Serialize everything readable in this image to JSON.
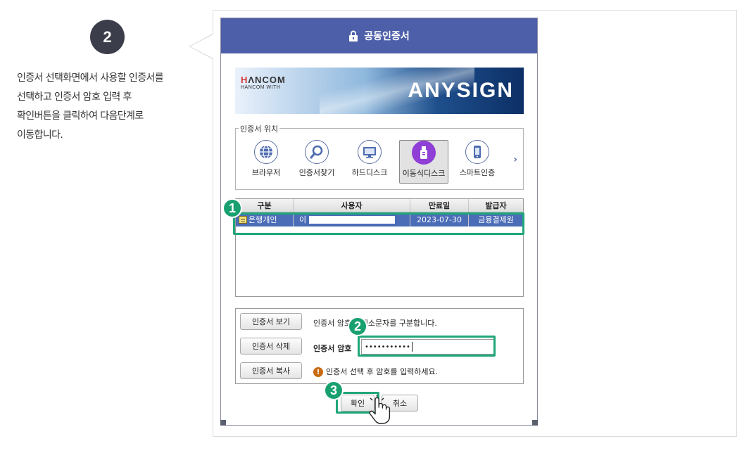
{
  "step": {
    "number": "2"
  },
  "description": "인증서 선택화면에서 사용할 인증서를\n선택하고 인증서 암호 입력 후\n확인버튼을 클릭하여 다음단계로\n이동합니다.",
  "dialog": {
    "title": "공동인증서",
    "banner": {
      "brand": "HANCOM",
      "brand_sub": "HANCOM WITH",
      "product": "ANYSIGN"
    },
    "location": {
      "legend": "인증서 위치",
      "items": [
        {
          "label": "브라우저",
          "icon": "globe-icon"
        },
        {
          "label": "인증서찾기",
          "icon": "search-icon"
        },
        {
          "label": "하드디스크",
          "icon": "monitor-icon"
        },
        {
          "label": "이동식디스크",
          "icon": "usb-icon",
          "selected": true
        },
        {
          "label": "스마트인증",
          "icon": "smartphone-icon"
        }
      ],
      "next": "›"
    },
    "table": {
      "headers": [
        "구분",
        "사용자",
        "만료일",
        "발급자"
      ],
      "rows": [
        {
          "type": "은행개인",
          "user": "이",
          "expiry": "2023-07-30",
          "issuer": "금융결제원"
        }
      ]
    },
    "buttons": {
      "view": "인증서 보기",
      "delete": "인증서 삭제",
      "copy": "인증서 복사",
      "ok": "확인",
      "cancel": "취소"
    },
    "case_hint": "인증서 암호는 대소문자를 구분합니다.",
    "password": {
      "label": "인증서 암호",
      "value": "•••••••••••"
    },
    "warning": "인증서 선택 후 암호를 입력하세요."
  },
  "markers": [
    "1",
    "2",
    "3"
  ],
  "colors": {
    "title_bar": "#4d5fa8",
    "selection": "#4b6cb7",
    "highlight": "#1fa77a",
    "step_circle": "#3b3d4a"
  }
}
